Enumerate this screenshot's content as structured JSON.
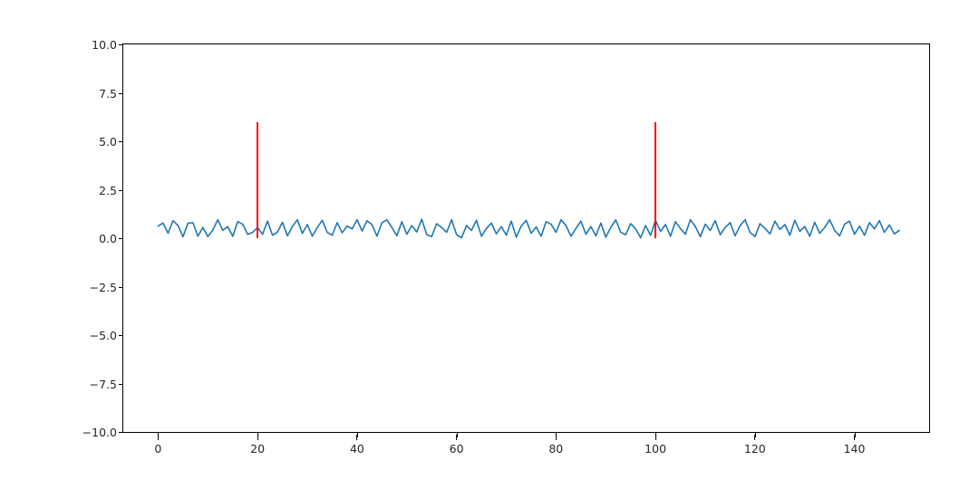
{
  "chart_data": {
    "type": "line",
    "title": "",
    "xlabel": "",
    "ylabel": "",
    "xlim": [
      -7,
      155
    ],
    "ylim": [
      -10,
      10
    ],
    "xticks": [
      0,
      20,
      40,
      60,
      80,
      100,
      120,
      140
    ],
    "yticks": [
      -10.0,
      -7.5,
      -5.0,
      -2.5,
      0.0,
      2.5,
      5.0,
      7.5,
      10.0
    ],
    "vlines": [
      {
        "x": 20,
        "ymin": 0,
        "ymax": 6,
        "color": "#ff0000"
      },
      {
        "x": 100,
        "ymin": 0,
        "ymax": 6,
        "color": "#ff0000"
      }
    ],
    "series": [
      {
        "name": "series0",
        "color": "#1f77b4",
        "x_start": 0,
        "x_step": 1,
        "values": [
          0.62,
          0.78,
          0.25,
          0.9,
          0.65,
          0.07,
          0.77,
          0.8,
          0.1,
          0.55,
          0.08,
          0.42,
          0.95,
          0.4,
          0.6,
          0.1,
          0.85,
          0.72,
          0.2,
          0.3,
          0.55,
          0.2,
          0.88,
          0.15,
          0.32,
          0.82,
          0.12,
          0.6,
          0.95,
          0.25,
          0.7,
          0.1,
          0.55,
          0.92,
          0.3,
          0.15,
          0.8,
          0.28,
          0.62,
          0.48,
          0.95,
          0.37,
          0.9,
          0.7,
          0.1,
          0.8,
          0.95,
          0.55,
          0.12,
          0.85,
          0.2,
          0.65,
          0.32,
          0.98,
          0.18,
          0.08,
          0.75,
          0.55,
          0.3,
          0.95,
          0.18,
          0.02,
          0.65,
          0.4,
          0.92,
          0.1,
          0.5,
          0.78,
          0.22,
          0.6,
          0.15,
          0.88,
          0.05,
          0.62,
          0.92,
          0.25,
          0.58,
          0.1,
          0.85,
          0.72,
          0.3,
          0.95,
          0.65,
          0.1,
          0.5,
          0.88,
          0.2,
          0.6,
          0.12,
          0.78,
          0.05,
          0.55,
          0.95,
          0.3,
          0.18,
          0.75,
          0.48,
          0.02,
          0.65,
          0.15,
          0.92,
          0.35,
          0.7,
          0.1,
          0.85,
          0.5,
          0.2,
          0.95,
          0.6,
          0.08,
          0.72,
          0.4,
          0.9,
          0.18,
          0.55,
          0.8,
          0.12,
          0.65,
          0.95,
          0.3,
          0.08,
          0.75,
          0.5,
          0.22,
          0.88,
          0.45,
          0.7,
          0.15,
          0.92,
          0.35,
          0.6,
          0.1,
          0.82,
          0.25,
          0.55,
          0.95,
          0.4,
          0.12,
          0.72,
          0.88,
          0.2,
          0.62,
          0.15,
          0.8,
          0.48,
          0.9,
          0.3,
          0.68,
          0.22,
          0.4
        ]
      }
    ]
  },
  "yticklabels": [
    "−10.0",
    "−7.5",
    "−5.0",
    "−2.5",
    "0.0",
    "2.5",
    "5.0",
    "7.5",
    "10.0"
  ],
  "xticklabels": [
    "0",
    "20",
    "40",
    "60",
    "80",
    "100",
    "120",
    "140"
  ]
}
